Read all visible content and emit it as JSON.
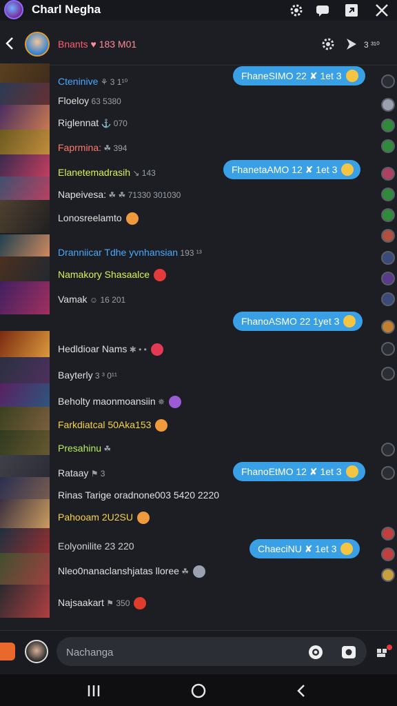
{
  "app": {
    "title": "Charl Negha",
    "top_icons": [
      "gear-icon",
      "chat-bubble-icon",
      "share-box-icon",
      "close-icon"
    ]
  },
  "header": {
    "name": "Bnants",
    "suffix": "♥ 183 M01",
    "count": "3 ³¹⁰"
  },
  "messages": [
    {
      "text": "Cteninive",
      "tail": "⚘ 3 1¹⁰",
      "color": "#47a9ff",
      "emoji": ""
    },
    {
      "text": "Floeloy",
      "tail": "63 5380",
      "color": "#e0e0e0",
      "emoji": ""
    },
    {
      "text": "Riglennat",
      "tail": "⚓ 070",
      "color": "#e0e0e0",
      "emoji": ""
    },
    {
      "text": "Faprmina:",
      "tail": "☘ 394",
      "color": "#ff7a6b",
      "emoji": ""
    },
    {
      "text": "Elanetemadrasih",
      "tail": "↘ 143",
      "color": "#d6f35a",
      "emoji": ""
    },
    {
      "text": "Napeivesa:",
      "tail": "☘ ☘ 71330 301030",
      "color": "#e0e0e0",
      "emoji": ""
    },
    {
      "text": "Lonosreelamto",
      "tail": "",
      "color": "#e0e0e0",
      "emoji": "#f09a3e"
    },
    {
      "text": "Dranniicar Tdhe yvnhansian",
      "tail": "193 ¹³",
      "color": "#47a9ff",
      "emoji": ""
    },
    {
      "text": "Namakory Shasaalce",
      "tail": "",
      "color": "#d6f35a",
      "emoji": "#e33b3b"
    },
    {
      "text": "Vamak",
      "tail": "☺ 16 201",
      "color": "#e0e0e0",
      "emoji": ""
    },
    {
      "text": "Hedldioar Nams",
      "tail": "✱ • •",
      "color": "#e0e0e0",
      "emoji": "#e23a55"
    },
    {
      "text": "Bayterly",
      "tail": "3 ³ 0¹¹",
      "color": "#e0e0e0",
      "emoji": ""
    },
    {
      "text": "Beholty maonmoansiin",
      "tail": "✵",
      "color": "#e0e0e0",
      "emoji": "#9c5bd6"
    },
    {
      "text": "Farkdiatcal 50Aka153",
      "tail": "",
      "color": "#f6d34a",
      "emoji": "#f09a3e"
    },
    {
      "text": "Presahinu",
      "tail": "☘",
      "color": "#b7f05a",
      "emoji": ""
    },
    {
      "text": "Rataay",
      "tail": "⚑ 3",
      "color": "#e0e0e0",
      "emoji": ""
    },
    {
      "text": "Rinas Tarige oradnone003 5420 2220",
      "tail": "",
      "color": "#e0e0e0",
      "emoji": ""
    },
    {
      "text": "Pahooam 2U2SU",
      "tail": "",
      "color": "#f6d34a",
      "emoji": "#f09a3e"
    },
    {
      "text": "Eolyonilite 23 220",
      "tail": "",
      "color": "#cfcfcf",
      "emoji": ""
    },
    {
      "text": "Nleo0nanaclanshjatas lloree",
      "tail": "☘",
      "color": "#e0e0e0",
      "emoji": "#9aa2b0"
    },
    {
      "text": "Najsaakart",
      "tail": "⚑ 350",
      "color": "#e0e0e0",
      "emoji": "#e03c2c"
    }
  ],
  "bubbles": [
    {
      "text": "FhaneSIMO 22 ✘ 1et 3"
    },
    {
      "text": "FhanetaAMO 12 ✘ 1et 3"
    },
    {
      "text": "FhanoASMO 22 1yet 3"
    },
    {
      "text": "FhanoEtMO 12 ✘ 1et 3"
    },
    {
      "text": "ChaeciNU ✘ 1et 3"
    }
  ],
  "composer": {
    "placeholder": "Nachanga"
  },
  "nav": {
    "icons": [
      "recents-icon",
      "home-icon",
      "back-icon"
    ]
  },
  "colors": {
    "background": "#1c1e24",
    "bubble": "#3aa0e6",
    "accent": "#ff5c6d"
  }
}
